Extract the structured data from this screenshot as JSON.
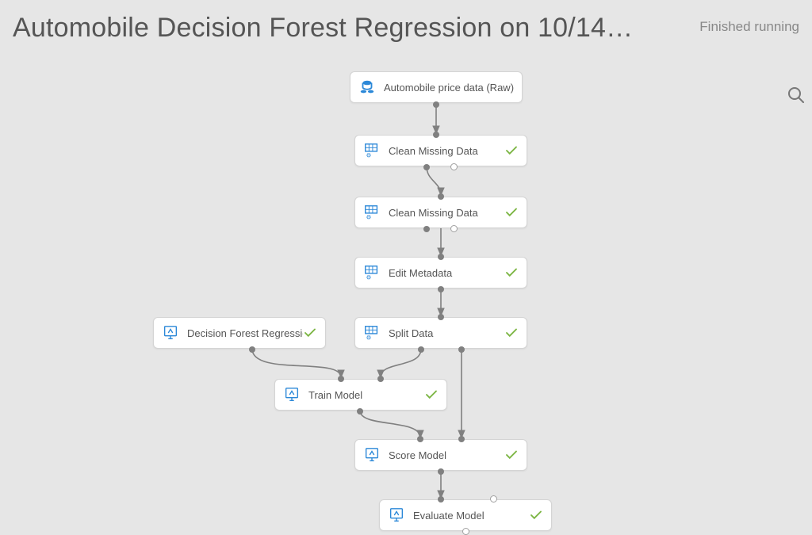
{
  "header": {
    "title": "Automobile Decision Forest Regression on 10/14…",
    "status": "Finished running"
  },
  "nodes": {
    "n1": {
      "label": "Automobile price data (Raw)",
      "icon": "dataset"
    },
    "n2": {
      "label": "Clean Missing Data",
      "icon": "grid",
      "status": "ok"
    },
    "n3": {
      "label": "Clean Missing Data",
      "icon": "grid",
      "status": "ok"
    },
    "n4": {
      "label": "Edit Metadata",
      "icon": "grid",
      "status": "ok"
    },
    "n5": {
      "label": "Split Data",
      "icon": "grid",
      "status": "ok"
    },
    "n6": {
      "label": "Decision Forest Regression",
      "icon": "compute",
      "status": "ok"
    },
    "n7": {
      "label": "Train Model",
      "icon": "compute",
      "status": "ok"
    },
    "n8": {
      "label": "Score Model",
      "icon": "compute",
      "status": "ok"
    },
    "n9": {
      "label": "Evaluate Model",
      "icon": "compute",
      "status": "ok"
    }
  },
  "colors": {
    "accent": "#2b88d8",
    "ok": "#7bb542",
    "port": "#808080"
  }
}
